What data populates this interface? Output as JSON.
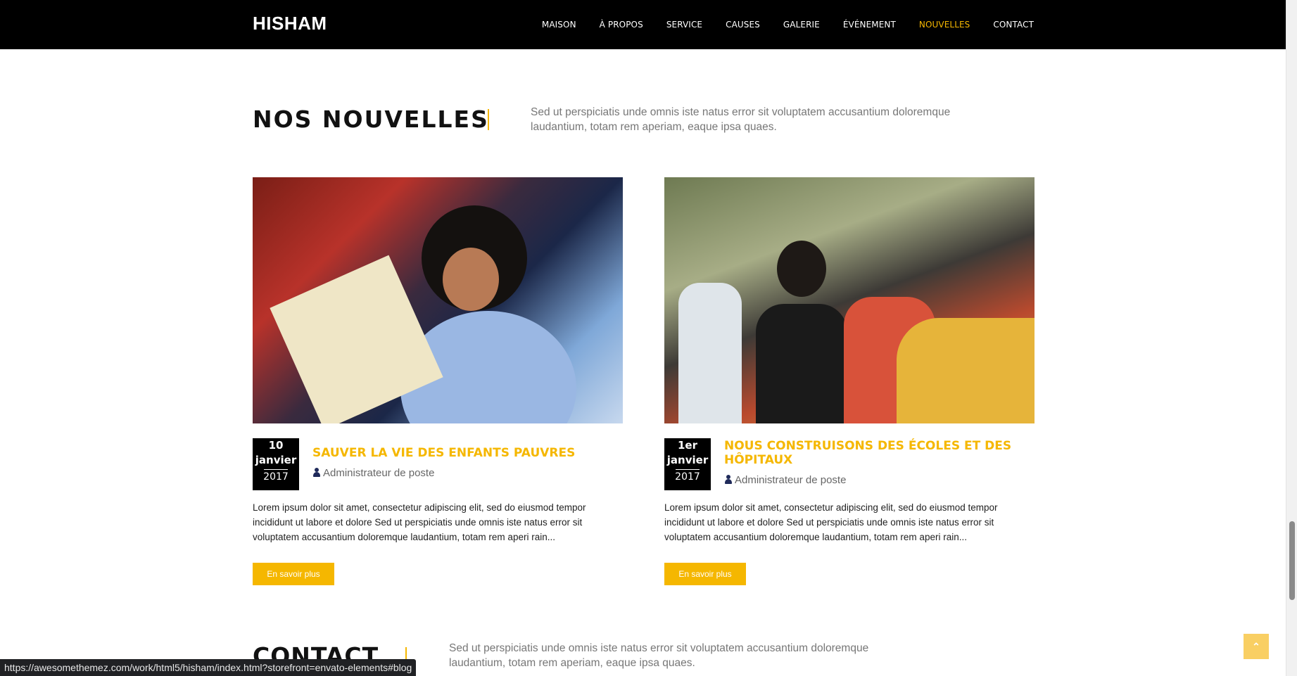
{
  "brand": {
    "logo": "HISHAM"
  },
  "nav": {
    "items": [
      {
        "label": "MAISON",
        "active": false
      },
      {
        "label": "À PROPOS",
        "active": false
      },
      {
        "label": "SERVICE",
        "active": false
      },
      {
        "label": "CAUSES",
        "active": false
      },
      {
        "label": "GALERIE",
        "active": false
      },
      {
        "label": "ÉVÉNEMENT",
        "active": false
      },
      {
        "label": "NOUVELLES",
        "active": true
      },
      {
        "label": "CONTACT",
        "active": false
      }
    ]
  },
  "news": {
    "title": "NOS NOUVELLES",
    "description": "Sed ut perspiciatis unde omnis iste natus error sit voluptatem accusantium doloremque laudantium, totam rem aperiam, eaque ipsa quaes.",
    "posts": [
      {
        "day": "10",
        "month": "janvier",
        "year": "2017",
        "title": "SAUVER LA VIE DES ENFANTS PAUVRES",
        "author": "Administrateur de poste",
        "excerpt": "Lorem ipsum dolor sit amet, consectetur adipiscing elit, sed do eiusmod tempor incididunt ut labore et dolore Sed ut perspiciatis unde omnis iste natus error sit voluptatem accusantium doloremque laudantium, totam rem aperi rain...",
        "button": "En savoir plus"
      },
      {
        "day": "1er",
        "month": "janvier",
        "year": "2017",
        "title": "NOUS CONSTRUISONS DES ÉCOLES ET DES HÔPITAUX",
        "author": "Administrateur de poste",
        "excerpt": "Lorem ipsum dolor sit amet, consectetur adipiscing elit, sed do eiusmod tempor incididunt ut labore et dolore Sed ut perspiciatis unde omnis iste natus error sit voluptatem accusantium doloremque laudantium, totam rem aperi rain...",
        "button": "En savoir plus"
      }
    ]
  },
  "contact": {
    "title": "CONTACT",
    "description": "Sed ut perspiciatis unde omnis iste natus error sit voluptatem accusantium doloremque laudantium, totam rem aperiam, eaque ipsa quaes."
  },
  "status": {
    "url": "https://awesomethemez.com/work/html5/hisham/index.html?storefront=envato-elements#blog"
  },
  "icons": {
    "author": "user-icon",
    "back_to_top": "double-chevron-up-icon"
  },
  "colors": {
    "accent": "#f5b700",
    "nav_bg": "#000000"
  }
}
